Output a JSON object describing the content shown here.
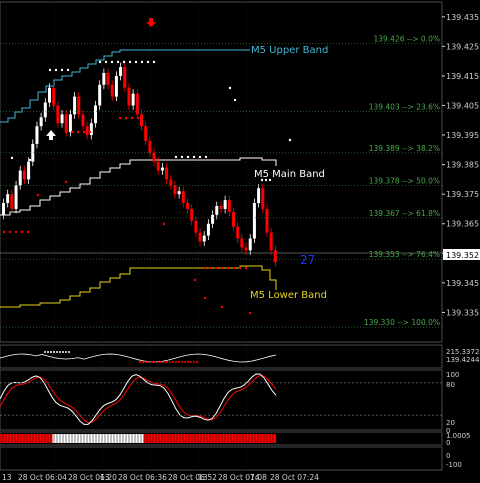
{
  "colors": {
    "background": "#000000",
    "bull": "#ffffff",
    "bear": "#ff0000",
    "upper_band": "#3fb7d6",
    "main_band": "#ffffff",
    "lower_band": "#e6d51a",
    "fib": "#2f8a2f",
    "grid": "#4a4a4a",
    "axis": "#cfcfcf",
    "counter": "#2233ff"
  },
  "counter_value": "27",
  "arrow_icon": "red-down-arrow",
  "bands": {
    "upper_label": "M5 Upper Band",
    "main_label": "M5 Main Band",
    "lower_label": "M5 Lower Band"
  },
  "fib_levels": [
    {
      "price": 139.426,
      "label": "139.426 --> 0.0%"
    },
    {
      "price": 139.403,
      "label": "139.403 --> 23.6%"
    },
    {
      "price": 139.389,
      "label": "139.389 --> 38.2%"
    },
    {
      "price": 139.378,
      "label": "139.378 --> 50.0%"
    },
    {
      "price": 139.367,
      "label": "139.367 --> 61.8%"
    },
    {
      "price": 139.353,
      "label": "139.353 --> 76.4%"
    },
    {
      "price": 139.33,
      "label": "139.330 --> 100.0%"
    }
  ],
  "price_axis": {
    "ticks": [
      "139.435",
      "139.425",
      "139.415",
      "139.405",
      "139.395",
      "139.385",
      "139.375",
      "139.365",
      "139.355",
      "139.345",
      "139.335"
    ],
    "current_price": "139.352"
  },
  "sub1_axis": [
    "215.3372",
    "139.4244"
  ],
  "sub2_axis": [
    "100",
    "80",
    "20",
    "0"
  ],
  "sub3_axis": [
    "1.0005",
    "0"
  ],
  "sub4_axis": [
    "0",
    "-100"
  ],
  "time_axis": [
    "13",
    "28 Oct 06:04",
    "28 Oct 06:20",
    "13",
    "28 Oct 06:36",
    "28 Oct 06:52",
    "13",
    "28 Oct 07:08",
    "14",
    "28 Oct 07:24"
  ],
  "chart_data": {
    "type": "candlestick",
    "symbol_hint": "M5 price bands with Fibonacci levels",
    "ylim": [
      139.325,
      139.44
    ],
    "fib_levels": [
      139.426,
      139.403,
      139.389,
      139.378,
      139.367,
      139.353,
      139.33
    ],
    "current_price": 139.352,
    "sub_indicator_bars": {
      "segments": [
        {
          "color": "red",
          "start": 0.0,
          "end": 0.19
        },
        {
          "color": "white",
          "start": 0.19,
          "end": 0.52
        },
        {
          "color": "red",
          "start": 0.52,
          "end": 1.0
        }
      ]
    }
  }
}
